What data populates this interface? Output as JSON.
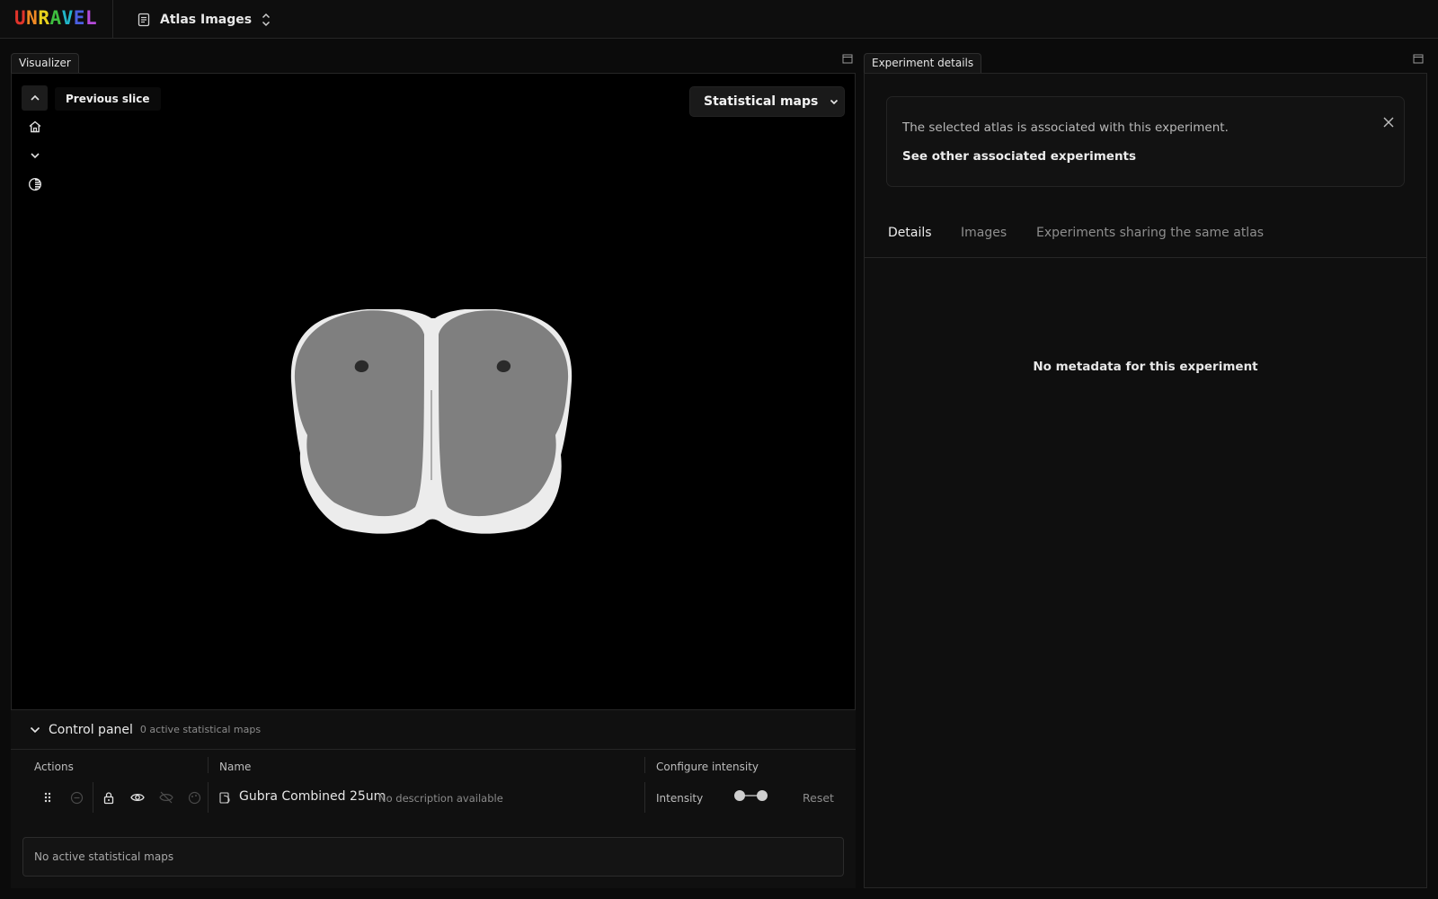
{
  "app": {
    "logo_letters": [
      {
        "ch": "U",
        "color": "#e0342b"
      },
      {
        "ch": "N",
        "color": "#f08a24"
      },
      {
        "ch": "R",
        "color": "#e8d21d"
      },
      {
        "ch": "A",
        "color": "#3fbf3f"
      },
      {
        "ch": "V",
        "color": "#21b6c9"
      },
      {
        "ch": "E",
        "color": "#4a5fe0"
      },
      {
        "ch": "L",
        "color": "#b54ad9"
      }
    ],
    "selector_title": "Atlas Images"
  },
  "visualizer": {
    "tab_label": "Visualizer",
    "tooltip": "Previous slice",
    "layer_button": "Statistical maps",
    "tools": [
      "chevron-up-icon",
      "home-icon",
      "chevron-down-icon",
      "contrast-icon"
    ]
  },
  "control_panel": {
    "title": "Control panel",
    "subtitle": "0 active statistical maps",
    "columns": {
      "actions": "Actions",
      "name": "Name",
      "configure": "Configure intensity"
    },
    "row": {
      "name": "Gubra Combined 25um",
      "description": "No description available",
      "intensity_label": "Intensity",
      "intensity_range": [
        0.0,
        1.0
      ],
      "reset_label": "Reset"
    },
    "empty_message": "No active statistical maps"
  },
  "experiment": {
    "tab_label": "Experiment details",
    "notice_text": "The selected atlas is associated with this experiment.",
    "notice_link": "See other associated experiments",
    "tabs": [
      {
        "label": "Details",
        "active": true
      },
      {
        "label": "Images",
        "active": false
      },
      {
        "label": "Experiments sharing the same atlas",
        "active": false
      }
    ],
    "empty_message": "No metadata for this experiment"
  }
}
